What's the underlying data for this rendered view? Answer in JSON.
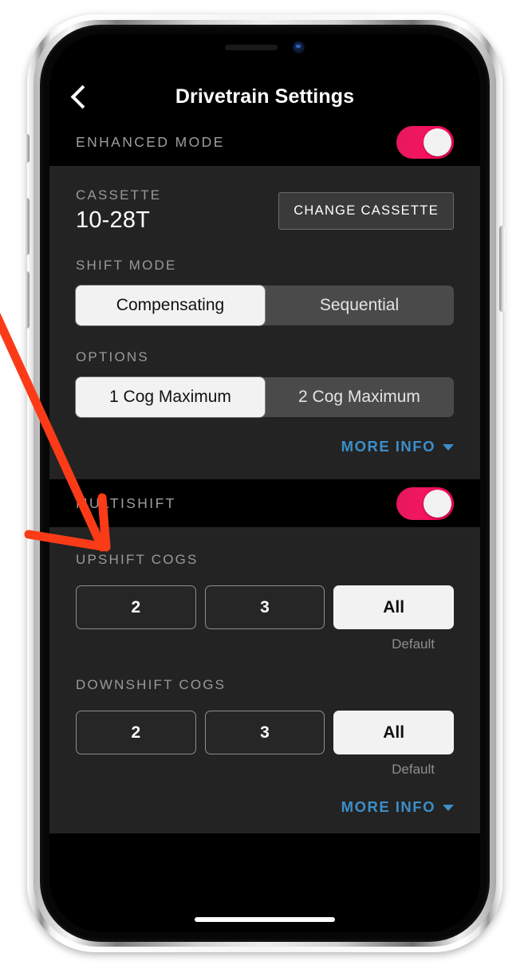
{
  "navbar": {
    "back_icon": "chevron-left-icon",
    "title": "Drivetrain Settings"
  },
  "enhanced_mode": {
    "label": "ENHANCED MODE",
    "toggle_state": "on",
    "cassette": {
      "label": "CASSETTE",
      "value": "10-28T",
      "change_button": "CHANGE CASSETTE"
    },
    "shift_mode": {
      "label": "SHIFT MODE",
      "options": [
        "Compensating",
        "Sequential"
      ],
      "selected": "Compensating"
    },
    "options": {
      "label": "OPTIONS",
      "options": [
        "1 Cog Maximum",
        "2 Cog Maximum"
      ],
      "selected": "1 Cog Maximum"
    },
    "more_info": {
      "label": "MORE INFO",
      "icon": "caret-down-icon"
    }
  },
  "multishift": {
    "label": "MULTISHIFT",
    "toggle_state": "on",
    "upshift": {
      "label": "UPSHIFT COGS",
      "options": [
        "2",
        "3",
        "All"
      ],
      "selected": "All",
      "default_note": "Default"
    },
    "downshift": {
      "label": "DOWNSHIFT COGS",
      "options": [
        "2",
        "3",
        "All"
      ],
      "selected": "All",
      "default_note": "Default"
    },
    "more_info": {
      "label": "MORE INFO",
      "icon": "caret-down-icon"
    }
  },
  "colors": {
    "accent_toggle": "#f0175f",
    "link_blue": "#3d8ec9",
    "panel_bg": "#232323",
    "screen_bg": "#000000",
    "annotation_red": "#fb3b17"
  }
}
